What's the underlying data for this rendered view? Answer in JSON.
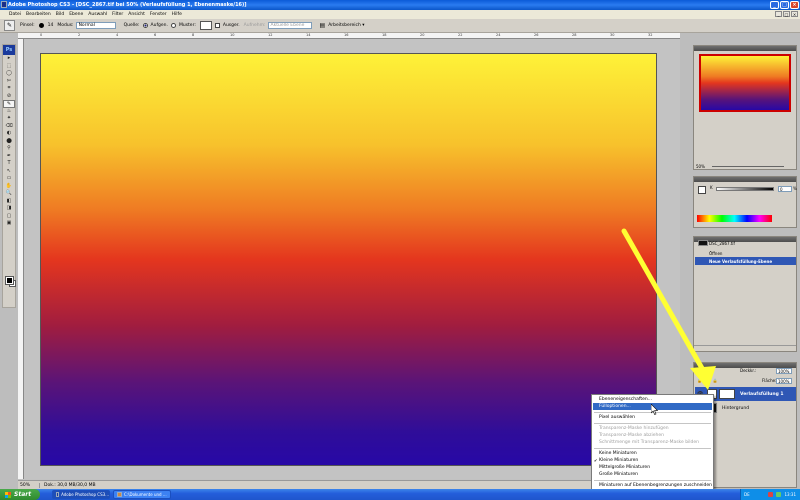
{
  "window": {
    "title": "Adobe Photoshop CS3 - [DSC_2867.tif bei 50% (Verlaufsfüllung 1, Ebenenmaske/16)]",
    "buttons": [
      "_",
      "□",
      "×"
    ]
  },
  "menubar": {
    "items": [
      "Datei",
      "Bearbeiten",
      "Bild",
      "Ebene",
      "Auswahl",
      "Filter",
      "Ansicht",
      "Fenster",
      "Hilfe"
    ]
  },
  "options": {
    "brush_label": "Pinsel:",
    "brush_size": "14",
    "mode_label": "Modus:",
    "mode_value": "Normal",
    "source_label": "Quelle:",
    "source_sampled": "Aufgen.",
    "source_pattern": "Muster:",
    "aligned": "Ausger.",
    "sample_label": "Aufnehm:",
    "sample_value": "Aktuelle Ebene",
    "workspace": "Arbeitsbereich ▾"
  },
  "toolbox": {
    "logo": "Ps",
    "tools": [
      "▸",
      "⬚",
      "◯",
      "✄",
      "⌗",
      "⊘",
      "✎",
      "♨",
      "✦",
      "⌫",
      "◐",
      "⬤",
      "⚲",
      "✒",
      "T",
      "↖",
      "▭",
      "✋",
      "🔍",
      "◧",
      "◨",
      "▢",
      "▣"
    ]
  },
  "document": {
    "ruler_numbers": [
      "0",
      "2",
      "4",
      "6",
      "8",
      "10",
      "12",
      "14",
      "16",
      "18",
      "20",
      "22",
      "24",
      "26",
      "28",
      "30",
      "32"
    ],
    "zoom": "50%",
    "doc_info": "Dok.: 30,0 MB/30,0 MB",
    "gradient_colors": [
      "#fef238",
      "#ef7a23",
      "#e4361e",
      "#5a1478",
      "#2708a6"
    ]
  },
  "navigator": {
    "zoom": "50%"
  },
  "color_panel": {
    "channel": "K",
    "value": "0",
    "unit": "%"
  },
  "history": {
    "items": [
      {
        "label": "DSC_2867.tif",
        "selected": false
      },
      {
        "label": "Öffnen",
        "selected": false
      },
      {
        "label": "Neue Verlaufsfüllung-Ebene",
        "selected": true
      }
    ]
  },
  "layers": {
    "opacity_label": "Deckkr.:",
    "opacity_value": "100%",
    "fill_label": "Fläche:",
    "fill_value": "100%",
    "rows": [
      {
        "name": "Verlaufsfüllung 1",
        "selected": true
      },
      {
        "name": "Hintergrund",
        "selected": false
      }
    ]
  },
  "context_menu": {
    "items": [
      {
        "label": "Ebeneneigenschaften...",
        "state": "normal"
      },
      {
        "label": "Fülloptionen...",
        "state": "highlighted"
      },
      {
        "label": "Pixel auswählen",
        "state": "normal"
      },
      {
        "label": "Transparenz-Maske hinzufügen",
        "state": "disabled"
      },
      {
        "label": "Transparenz-Maske abziehen",
        "state": "disabled"
      },
      {
        "label": "Schnittmenge mit Transparenz-Maske bilden",
        "state": "disabled"
      },
      {
        "label": "Keine Miniaturen",
        "state": "normal"
      },
      {
        "label": "Kleine Miniaturen",
        "state": "checked"
      },
      {
        "label": "Mittelgroße Miniaturen",
        "state": "normal"
      },
      {
        "label": "Große Miniaturen",
        "state": "normal"
      },
      {
        "label": "Miniaturen auf Ebenenbegrenzungen zuschneiden",
        "state": "normal"
      },
      {
        "label": "Miniaturen auf Dokumentbegrenzungen zuschneiden",
        "state": "checked"
      }
    ]
  },
  "annotation": {
    "arrow_color": "#ffff33"
  },
  "taskbar": {
    "start": "Start",
    "tasks": [
      {
        "label": "Adobe Photoshop CS3...",
        "active": true
      },
      {
        "label": "C:\\Dokumente und ...",
        "active": false
      }
    ],
    "lang": "DE",
    "time": "13:31"
  }
}
